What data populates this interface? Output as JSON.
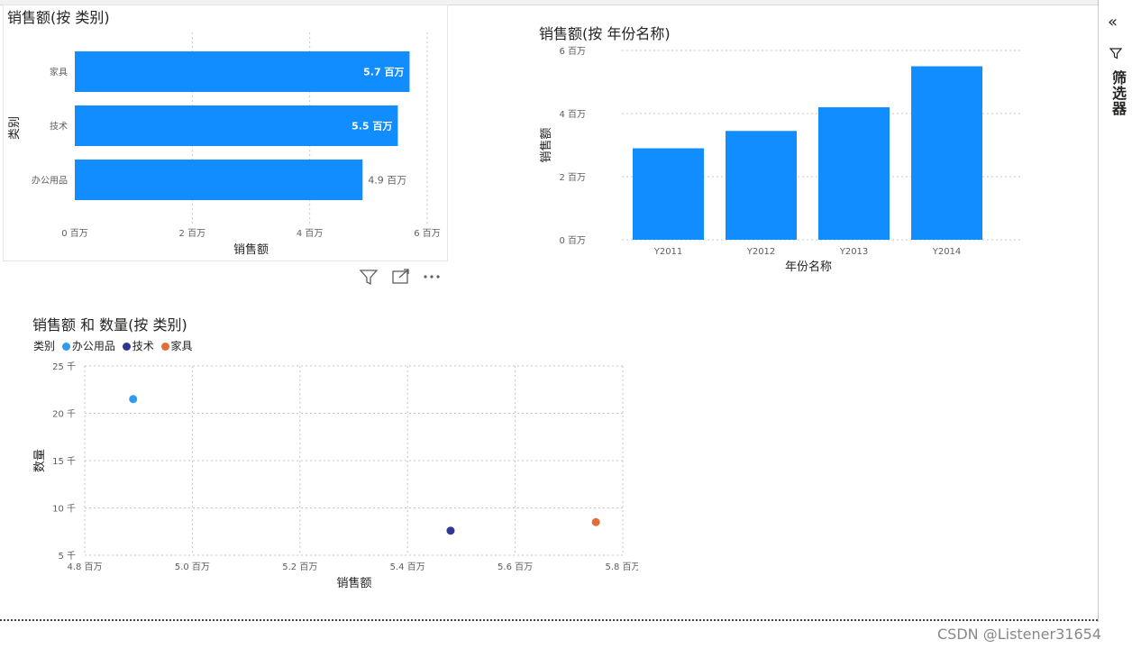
{
  "colors": {
    "bar": "#118dff",
    "office": "#2f9bf0",
    "tech": "#2f3894",
    "furniture": "#e66c37"
  },
  "filter_pane": {
    "label": "筛选器",
    "collapse_icon": "double-chevron-left-icon",
    "funnel_icon": "filter-icon"
  },
  "watermark": "CSDN @Listener31654",
  "visual_header_icons": [
    "filter-icon",
    "focus-mode-icon",
    "more-options-icon"
  ],
  "chart_data": [
    {
      "type": "bar",
      "orientation": "horizontal",
      "title": "销售额(按 类别)",
      "xlabel": "销售额",
      "ylabel": "类别",
      "categories": [
        "家具",
        "技术",
        "办公用品"
      ],
      "values": [
        5.7,
        5.5,
        4.9
      ],
      "data_labels": [
        "5.7 百万",
        "5.5 百万",
        "4.9 百万"
      ],
      "xticks": [
        "0 百万",
        "2 百万",
        "4 百万",
        "6 百万"
      ],
      "xlim": [
        0,
        6
      ],
      "grid": true
    },
    {
      "type": "bar",
      "title": "销售额(按 年份名称)",
      "xlabel": "年份名称",
      "ylabel": "销售额",
      "categories": [
        "Y2011",
        "Y2012",
        "Y2013",
        "Y2014"
      ],
      "values": [
        2.9,
        3.45,
        4.2,
        5.5
      ],
      "yticks": [
        "6 百万",
        "4 百万",
        "2 百万",
        "0 百万"
      ],
      "ylim": [
        0,
        6
      ],
      "grid": true
    },
    {
      "type": "scatter",
      "title": "销售额 和 数量(按 类别)",
      "legend_title": "类别",
      "xlabel": "销售额",
      "ylabel": "数量",
      "series": [
        {
          "name": "办公用品",
          "x": 4.89,
          "y": 21.5
        },
        {
          "name": "技术",
          "x": 5.48,
          "y": 7.6
        },
        {
          "name": "家具",
          "x": 5.75,
          "y": 8.5
        }
      ],
      "xticks": [
        "4.8 百万",
        "5.0 百万",
        "5.2 百万",
        "5.4 百万",
        "5.6 百万",
        "5.8 百万"
      ],
      "yticks": [
        "25 千",
        "20 千",
        "15 千",
        "10 千",
        "5 千"
      ],
      "xlim": [
        4.8,
        5.8
      ],
      "ylim": [
        5,
        25
      ],
      "grid": true
    }
  ]
}
